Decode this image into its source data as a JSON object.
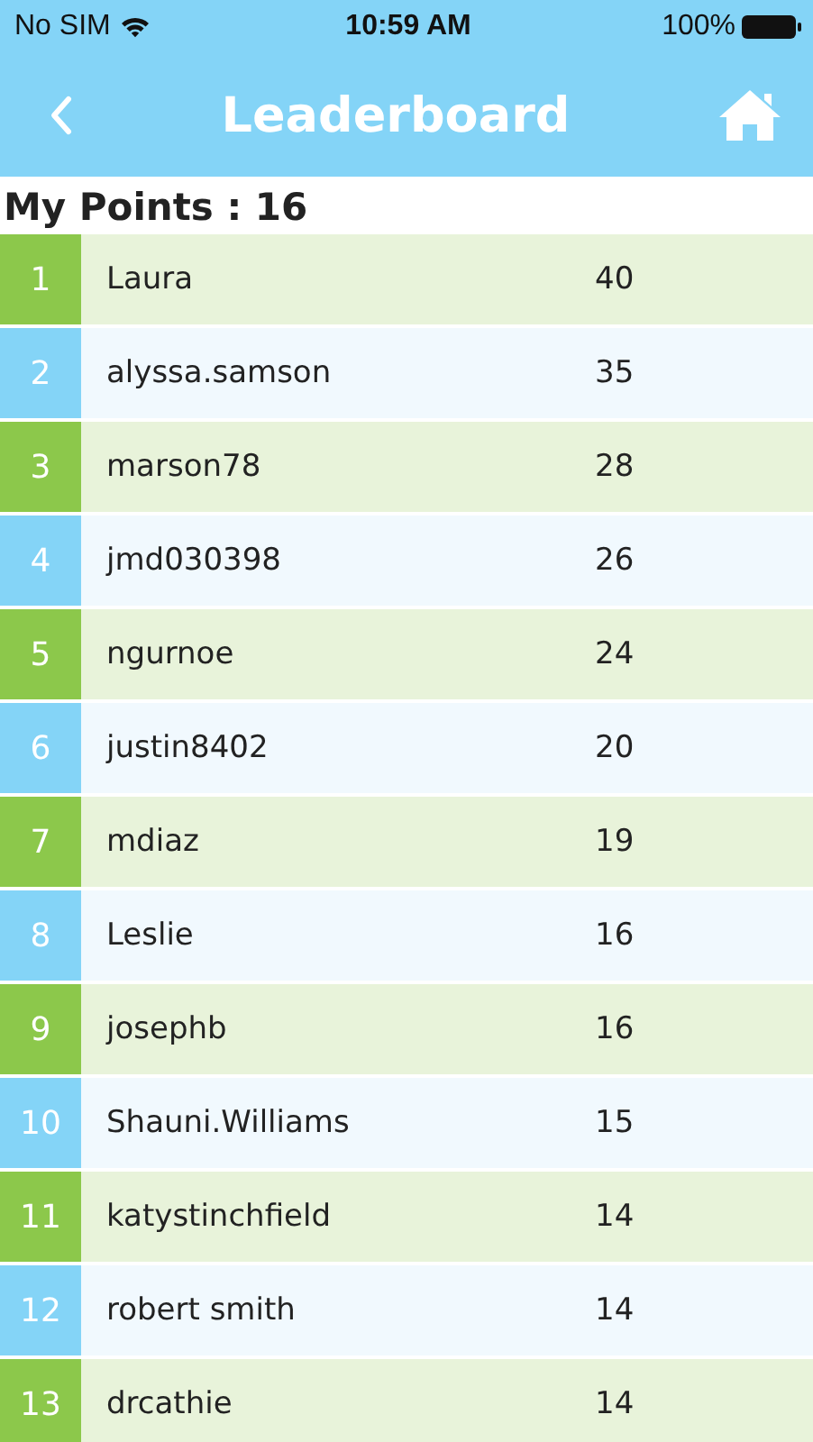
{
  "status_bar": {
    "carrier": "No SIM",
    "time": "10:59 AM",
    "battery": "100%"
  },
  "header": {
    "title": "Leaderboard"
  },
  "my_points": "My Points : 16",
  "rows": [
    {
      "rank": "1",
      "name": "Laura",
      "points": "40"
    },
    {
      "rank": "2",
      "name": "alyssa.samson",
      "points": "35"
    },
    {
      "rank": "3",
      "name": "marson78",
      "points": "28"
    },
    {
      "rank": "4",
      "name": "jmd030398",
      "points": "26"
    },
    {
      "rank": "5",
      "name": "ngurnoe",
      "points": "24"
    },
    {
      "rank": "6",
      "name": "justin8402",
      "points": "20"
    },
    {
      "rank": "7",
      "name": "mdiaz",
      "points": "19"
    },
    {
      "rank": "8",
      "name": "Leslie",
      "points": "16"
    },
    {
      "rank": "9",
      "name": "josephb",
      "points": "16"
    },
    {
      "rank": "10",
      "name": "Shauni.Williams",
      "points": "15"
    },
    {
      "rank": "11",
      "name": "katystinchfield",
      "points": "14"
    },
    {
      "rank": "12",
      "name": "robert smith",
      "points": "14"
    },
    {
      "rank": "13",
      "name": "drcathie",
      "points": "14"
    }
  ]
}
